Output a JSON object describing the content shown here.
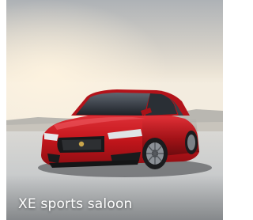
{
  "tile": {
    "caption": "XE sports saloon",
    "car_color": "#c4161c",
    "image_alt": "Red XE sports saloon parked on a pale salt flat under a hazy sky"
  }
}
